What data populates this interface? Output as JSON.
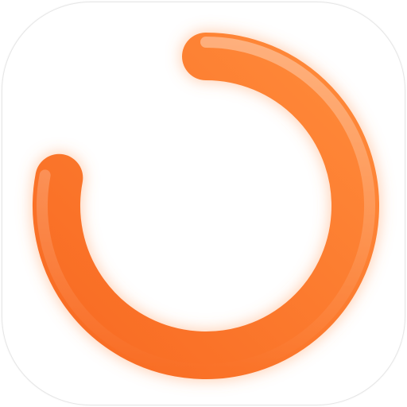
{
  "app_icon": {
    "icon_name": "progress-ring-icon",
    "progress_fraction": 0.78,
    "colors": {
      "background": "#ffffff",
      "arc_start": "#f86a22",
      "arc_end": "#ff8a3a",
      "glow": "#ff9a5c"
    }
  }
}
